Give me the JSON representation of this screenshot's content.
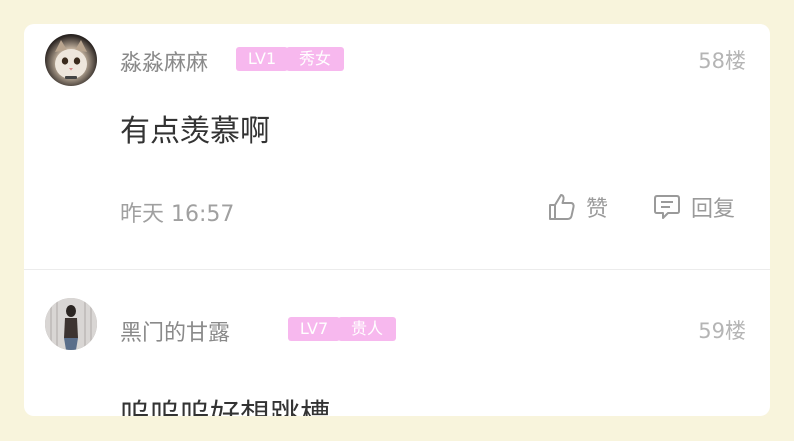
{
  "comments": [
    {
      "username": "淼淼麻麻",
      "level": "LV1",
      "title": "秀女",
      "floor": "58楼",
      "text": "有点羡慕啊",
      "time": "昨天 16:57",
      "like_label": "赞",
      "reply_label": "回复"
    },
    {
      "username": "黑门的甘露",
      "level": "LV7",
      "title": "贵人",
      "floor": "59楼",
      "text": "呜呜呜好想跳槽"
    }
  ],
  "colors": {
    "page_bg": "#f8f4dc",
    "card_bg": "#ffffff",
    "badge_bg": "#f7b8ee",
    "name_text": "#8a8a8a",
    "body_text": "#333333",
    "meta_text": "#a0a0a0"
  },
  "icons": [
    "thumbs-up-icon",
    "comment-icon"
  ]
}
